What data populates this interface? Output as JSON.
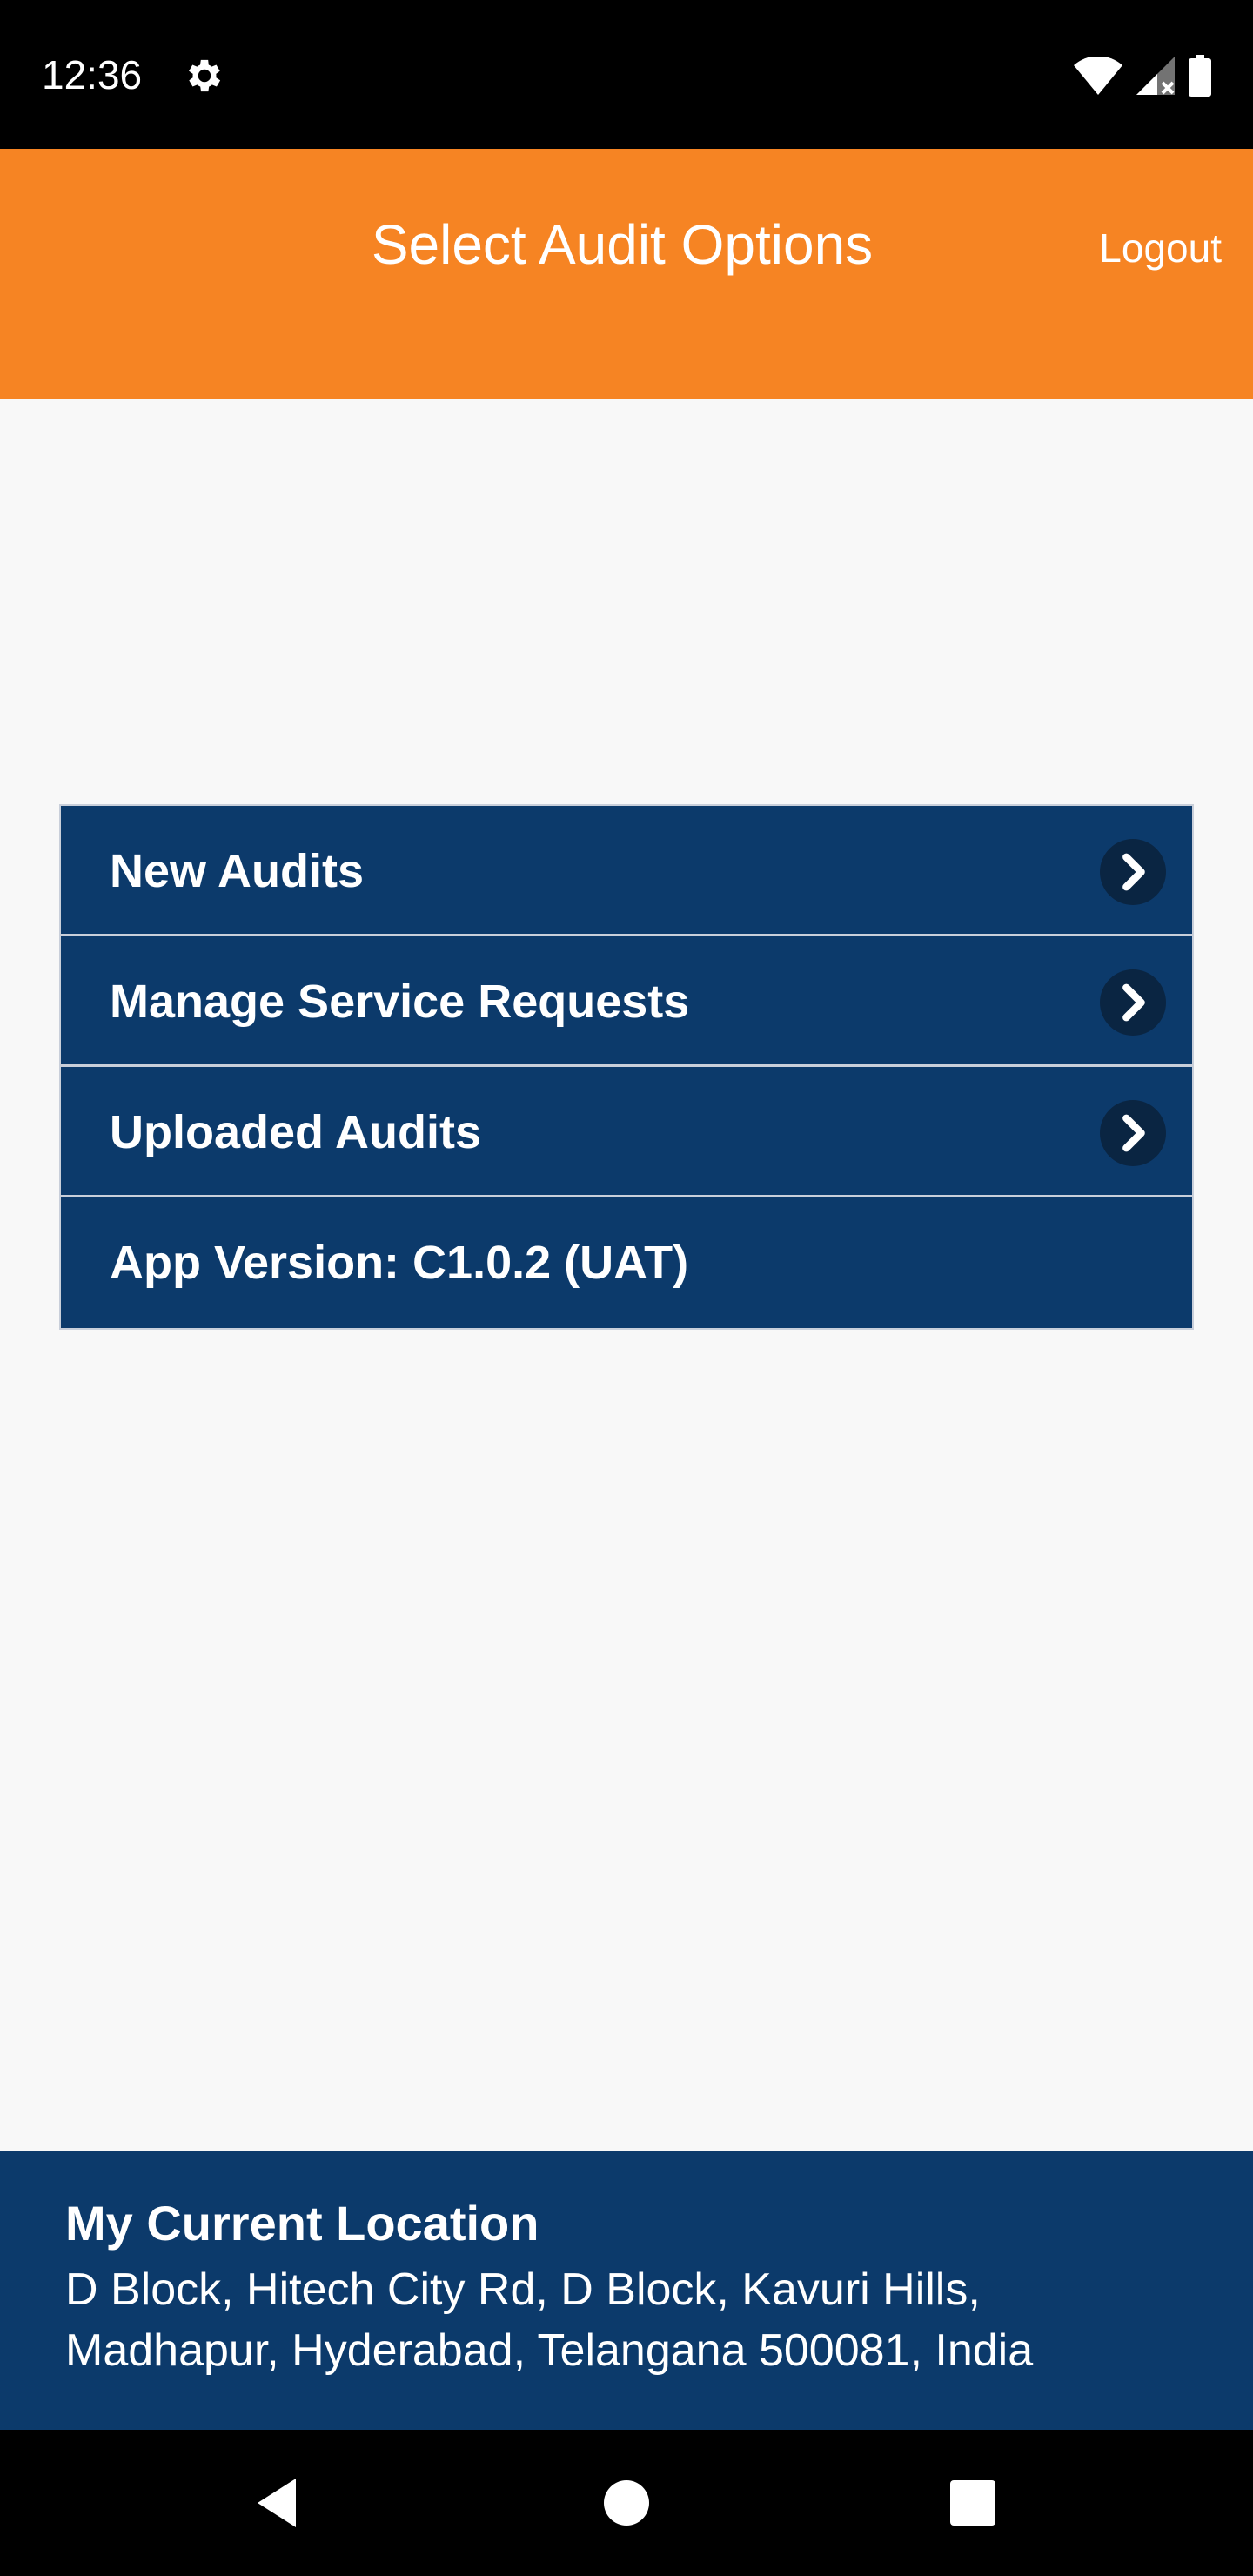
{
  "status_bar": {
    "time": "12:36",
    "icons": [
      "gear-icon",
      "wifi-icon",
      "signal-icon",
      "battery-icon"
    ]
  },
  "header": {
    "title": "Select Audit Options",
    "logout_label": "Logout",
    "background_color": "#f68423"
  },
  "menu": {
    "background_color": "#0c3a6b",
    "items": [
      {
        "label": "New Audits",
        "icon": "chevron-right-icon"
      },
      {
        "label": "Manage Service Requests",
        "icon": "chevron-right-icon"
      },
      {
        "label": "Uploaded Audits",
        "icon": "chevron-right-icon"
      }
    ],
    "app_version": "App Version: C1.0.2 (UAT)"
  },
  "footer": {
    "title": "My Current Location",
    "address": "D Block, Hitech City Rd, D Block, Kavuri Hills, Madhapur, Hyderabad, Telangana 500081, India"
  },
  "nav_bar": {
    "buttons": [
      "back-icon",
      "home-icon",
      "recents-icon"
    ]
  }
}
